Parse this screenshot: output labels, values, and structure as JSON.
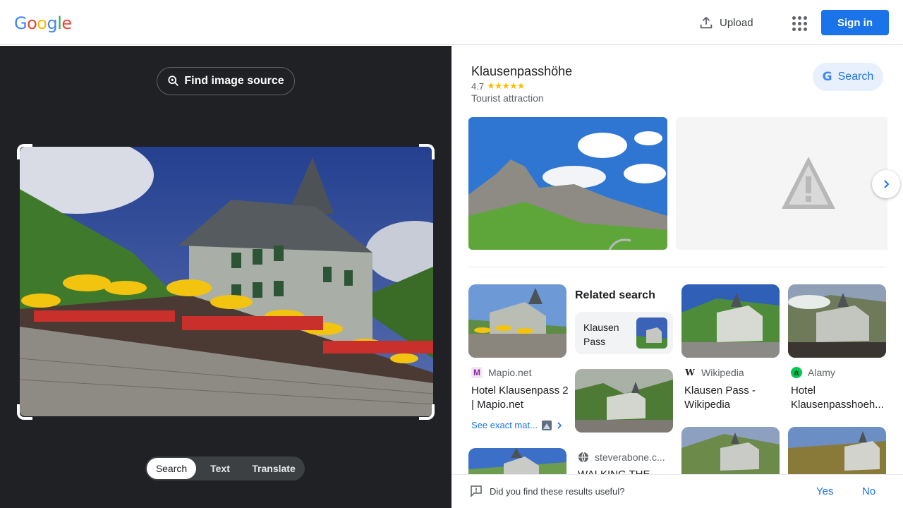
{
  "header": {
    "logo": [
      "G",
      "o",
      "o",
      "g",
      "l",
      "e"
    ],
    "logo_colors": [
      "#4285F4",
      "#EA4335",
      "#FBBC05",
      "#4285F4",
      "#34A853",
      "#EA4335"
    ],
    "upload_label": "Upload",
    "signin_label": "Sign in"
  },
  "lens": {
    "find_source_label": "Find image source",
    "modes": [
      "Search",
      "Text",
      "Translate"
    ],
    "active_mode": "Search"
  },
  "knowledge": {
    "title": "Klausenpasshöhe",
    "rating": "4.7",
    "stars": "★★★★★",
    "category": "Tourist attraction",
    "search_label": "Search"
  },
  "results": [
    {
      "source": "Mapio.net",
      "icon": "M",
      "title": "Hotel Klausenpass 2 | Mapio.net"
    },
    {
      "source": "Wikipedia",
      "icon": "W",
      "title": "Klausen Pass - Wikipedia"
    },
    {
      "source": "Alamy",
      "icon": "a",
      "title": "Hotel Klausenpasshoeh..."
    },
    {
      "source": "steverabone.c...",
      "icon": "globe",
      "title": "WALKING THE ..."
    }
  ],
  "related": {
    "heading": "Related search",
    "chip_label": "Klausen Pass"
  },
  "see_exact": "See exact mat...",
  "feedback": {
    "question": "Did you find these results useful?",
    "yes": "Yes",
    "no": "No"
  },
  "colors": {
    "accent": "#1a73e8",
    "dark_panel": "#202124",
    "star": "#fbbc04"
  }
}
